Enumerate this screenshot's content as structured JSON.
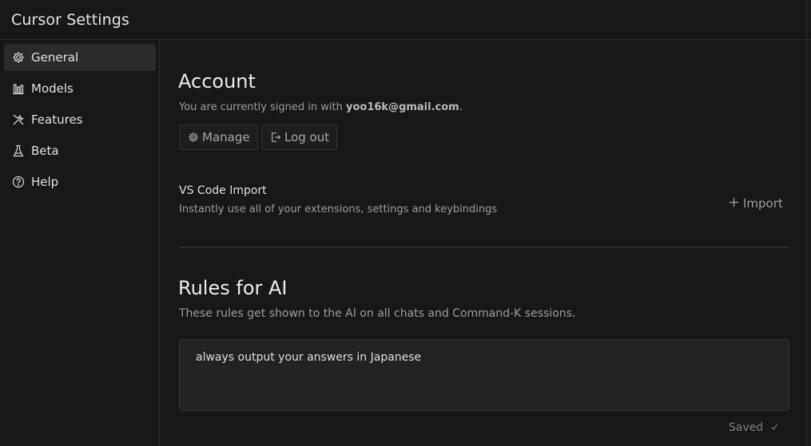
{
  "window": {
    "title": "Cursor Settings"
  },
  "sidebar": {
    "items": [
      {
        "label": "General",
        "icon": "gear-icon",
        "active": true
      },
      {
        "label": "Models",
        "icon": "bar-chart-icon",
        "active": false
      },
      {
        "label": "Features",
        "icon": "tools-icon",
        "active": false
      },
      {
        "label": "Beta",
        "icon": "flask-icon",
        "active": false
      },
      {
        "label": "Help",
        "icon": "help-circle-icon",
        "active": false
      }
    ]
  },
  "account": {
    "heading": "Account",
    "signed_in_prefix": "You are currently signed in with ",
    "email": "yoo16k@gmail.com",
    "signed_in_suffix": ".",
    "manage_label": "Manage",
    "logout_label": "Log out"
  },
  "vscode_import": {
    "title": "VS Code Import",
    "description": "Instantly use all of your extensions, settings and keybindings",
    "import_label": "Import"
  },
  "rules": {
    "heading": "Rules for AI",
    "description": "These rules get shown to the AI on all chats and Command-K sessions.",
    "value": "always output your answers in Japanese",
    "status": "Saved"
  },
  "colors": {
    "background": "#181818",
    "active_item": "#2a2a2a",
    "text": "#e0e0e0",
    "muted": "#9b9b9b"
  }
}
